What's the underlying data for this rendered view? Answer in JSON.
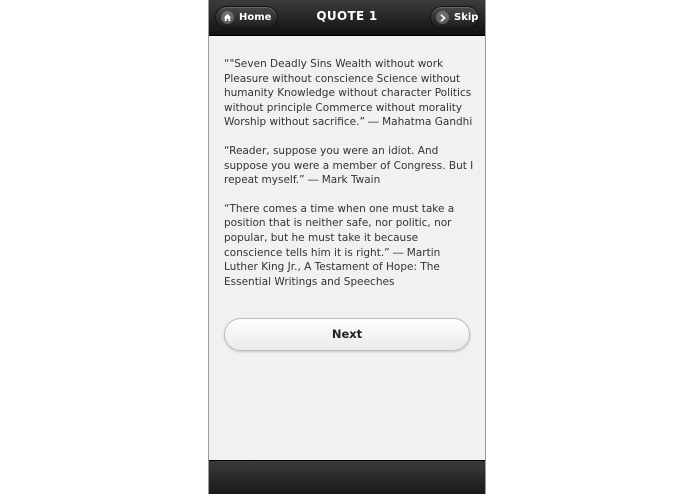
{
  "header": {
    "title": "QUOTE 1",
    "home_label": "Home",
    "skip_label": "Skip",
    "home_icon": "home-icon",
    "skip_icon": "chevron-right-icon"
  },
  "quotes": [
    "“\"Seven Deadly Sins Wealth without work Pleasure without conscience Science without humanity Knowledge without character Politics without principle Commerce without morality Worship without sacrifice.” ― Mahatma Gandhi",
    "“Reader, suppose you were an idiot. And suppose you were a member of Congress. But I repeat myself.” ― Mark Twain",
    "“There comes a time when one must take a position that is neither safe, nor politic, nor popular, but he must take it because conscience tells him it is right.” ― Martin Luther King Jr., A Testament of Hope: The Essential Writings and Speeches"
  ],
  "next_label": "Next",
  "colors": {
    "header_bg": "#1a1a1a",
    "content_bg": "#f1f1f1",
    "text": "#333333"
  }
}
